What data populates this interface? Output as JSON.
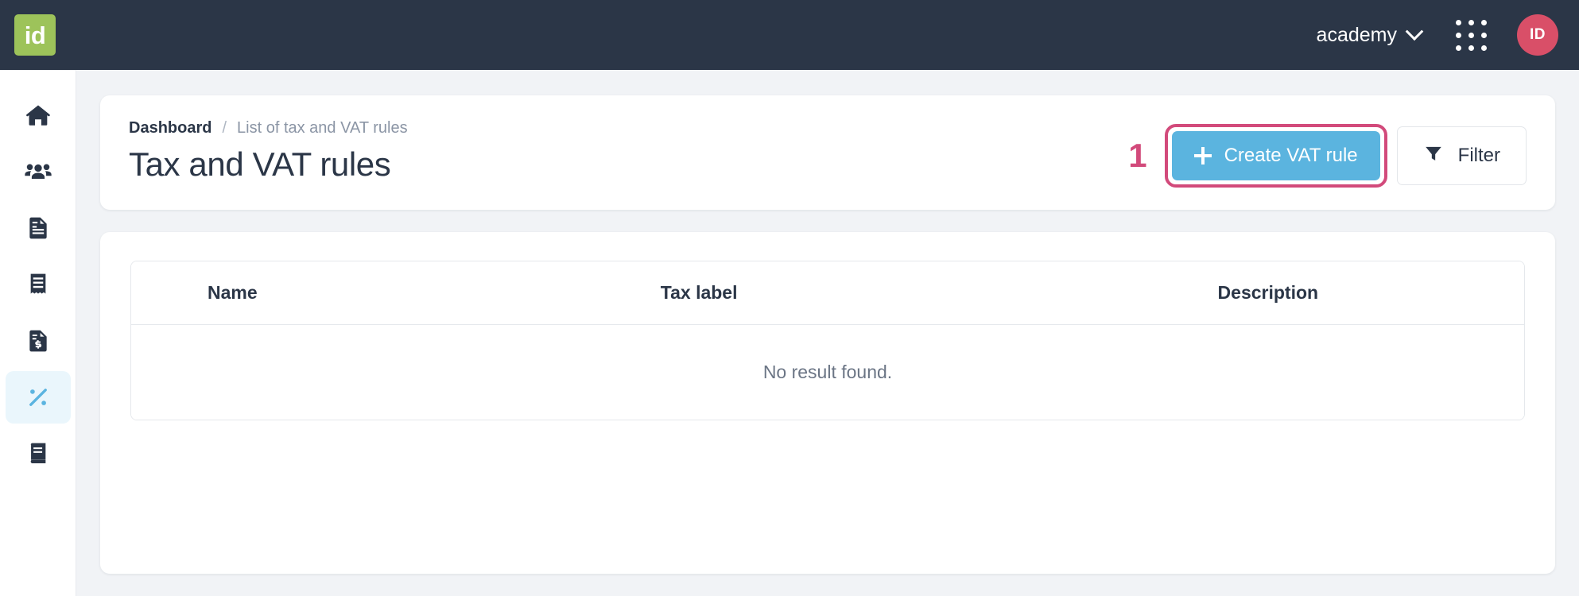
{
  "topbar": {
    "logo_text": "id",
    "logo_color": "#9dc35a",
    "background": "#2b3647",
    "org_name": "academy",
    "chevron_icon": "chevron-down-icon",
    "apps_icon": "grid-apps-icon",
    "avatar_initials": "ID",
    "avatar_color": "#d94f68"
  },
  "sidebar": {
    "items": [
      {
        "icon": "home-icon",
        "active": false
      },
      {
        "icon": "people-icon",
        "active": false
      },
      {
        "icon": "document-icon",
        "active": false
      },
      {
        "icon": "receipt-icon",
        "active": false
      },
      {
        "icon": "invoice-dollar-icon",
        "active": false
      },
      {
        "icon": "percent-icon",
        "active": true
      },
      {
        "icon": "book-icon",
        "active": false
      }
    ],
    "active_color": "#5bb4e0",
    "active_background": "#eaf6fc"
  },
  "header": {
    "breadcrumb": {
      "current": "Dashboard",
      "separator": "/",
      "link": "List of tax and VAT rules"
    },
    "title": "Tax and VAT rules",
    "step_badge": "1",
    "step_badge_color": "#d24a7b",
    "create_button": {
      "label": "Create VAT rule",
      "icon": "plus-icon",
      "color": "#5bb4df",
      "highlighted": true
    },
    "filter_button": {
      "label": "Filter",
      "icon": "filter-funnel-icon"
    }
  },
  "table": {
    "columns": [
      "Name",
      "Tax label",
      "Description"
    ],
    "rows": [],
    "empty_message": "No result found."
  }
}
